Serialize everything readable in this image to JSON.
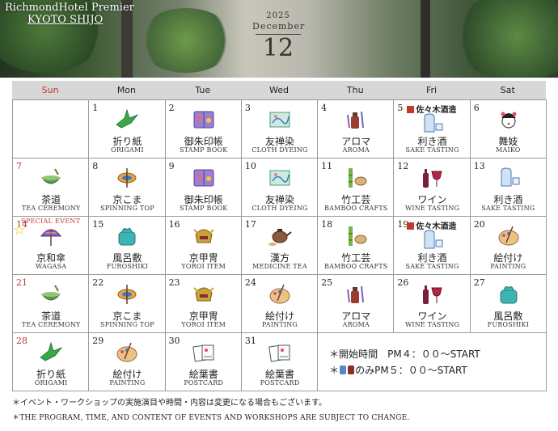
{
  "hotel": {
    "name": "RichmondHotel Premier",
    "sub": "KYOTO SHIJO"
  },
  "date": {
    "year": "2025",
    "month": "December",
    "day": "12"
  },
  "weekdays": [
    "Sun",
    "Mon",
    "Tue",
    "Wed",
    "Thu",
    "Fri",
    "Sat"
  ],
  "colors": {
    "sunday": "#c0392b",
    "header_bg": "#d7d7d7",
    "grid_line": "#999999"
  },
  "events": [
    {
      "day": "1",
      "jp": "折り紙",
      "en": "ORIGAMI",
      "icon": "origami-crane-icon"
    },
    {
      "day": "2",
      "jp": "御朱印帳",
      "en": "STAMP BOOK",
      "icon": "stamp-book-icon"
    },
    {
      "day": "3",
      "jp": "友禅染",
      "en": "CLOTH DYEING",
      "icon": "cloth-dyeing-icon"
    },
    {
      "day": "4",
      "jp": "アロマ",
      "en": "AROMA",
      "icon": "aroma-bottle-icon"
    },
    {
      "day": "5",
      "jp": "利き酒",
      "en": "SAKE TASTING",
      "icon": "sake-icon",
      "brand": "佐々木酒造"
    },
    {
      "day": "6",
      "jp": "舞妓",
      "en": "MAIKO",
      "icon": "maiko-icon"
    },
    {
      "day": "7",
      "jp": "茶道",
      "en": "TEA CEREMONY",
      "icon": "tea-bowl-icon"
    },
    {
      "day": "8",
      "jp": "京こま",
      "en": "SPINNING TOP",
      "icon": "spinning-top-icon"
    },
    {
      "day": "9",
      "jp": "御朱印帳",
      "en": "STAMP BOOK",
      "icon": "stamp-book-icon"
    },
    {
      "day": "10",
      "jp": "友禅染",
      "en": "CLOTH DYEING",
      "icon": "cloth-dyeing-icon"
    },
    {
      "day": "11",
      "jp": "竹工芸",
      "en": "BAMBOO CRAFTS",
      "icon": "bamboo-icon"
    },
    {
      "day": "12",
      "jp": "ワイン",
      "en": "WINE TASTING",
      "icon": "wine-icon"
    },
    {
      "day": "13",
      "jp": "利き酒",
      "en": "SAKE TASTING",
      "icon": "sake-icon"
    },
    {
      "day": "14",
      "jp": "京和傘",
      "en": "WAGASA",
      "icon": "umbrella-icon",
      "special": "SPECIAL EVENT"
    },
    {
      "day": "15",
      "jp": "風呂敷",
      "en": "FUROSHIKI",
      "icon": "furoshiki-icon"
    },
    {
      "day": "16",
      "jp": "京甲冑",
      "en": "YOROI ITEM",
      "icon": "armor-icon"
    },
    {
      "day": "17",
      "jp": "漢方",
      "en": "MEDICINE TEA",
      "icon": "teapot-icon"
    },
    {
      "day": "18",
      "jp": "竹工芸",
      "en": "BAMBOO CRAFTS",
      "icon": "bamboo-icon"
    },
    {
      "day": "19",
      "jp": "利き酒",
      "en": "SAKE TASTING",
      "icon": "sake-icon",
      "brand": "佐々木酒造"
    },
    {
      "day": "20",
      "jp": "絵付け",
      "en": "PAINTING",
      "icon": "palette-icon"
    },
    {
      "day": "21",
      "jp": "茶道",
      "en": "TEA CEREMONY",
      "icon": "tea-bowl-icon"
    },
    {
      "day": "22",
      "jp": "京こま",
      "en": "SPINNING TOP",
      "icon": "spinning-top-icon"
    },
    {
      "day": "23",
      "jp": "京甲冑",
      "en": "YOROI ITEM",
      "icon": "armor-icon"
    },
    {
      "day": "24",
      "jp": "絵付け",
      "en": "PAINTING",
      "icon": "palette-icon"
    },
    {
      "day": "25",
      "jp": "アロマ",
      "en": "AROMA",
      "icon": "aroma-bottle-icon"
    },
    {
      "day": "26",
      "jp": "ワイン",
      "en": "WINE TASTING",
      "icon": "wine-icon"
    },
    {
      "day": "27",
      "jp": "風呂敷",
      "en": "FUROSHIKI",
      "icon": "furoshiki-icon"
    },
    {
      "day": "28",
      "jp": "折り紙",
      "en": "ORIGAMI",
      "icon": "origami-crane-icon"
    },
    {
      "day": "29",
      "jp": "絵付け",
      "en": "PAINTING",
      "icon": "palette-icon"
    },
    {
      "day": "30",
      "jp": "絵葉書",
      "en": "POSTCARD",
      "icon": "postcard-icon"
    },
    {
      "day": "31",
      "jp": "絵葉書",
      "en": "POSTCARD",
      "icon": "postcard-icon"
    }
  ],
  "info": {
    "start_time": "＊開始時間　PM４：００～START",
    "wine_sake_prefix": "＊",
    "wine_sake_time": "のみPM５：００～START"
  },
  "notes": {
    "jp": "＊イベント・ワークショップの実施演目や時間・内容は変更になる場合もございます。",
    "en": "＊THE PROGRAM, TIME, AND CONTENT OF EVENTS AND WORKSHOPS ARE SUBJECT TO CHANGE."
  }
}
